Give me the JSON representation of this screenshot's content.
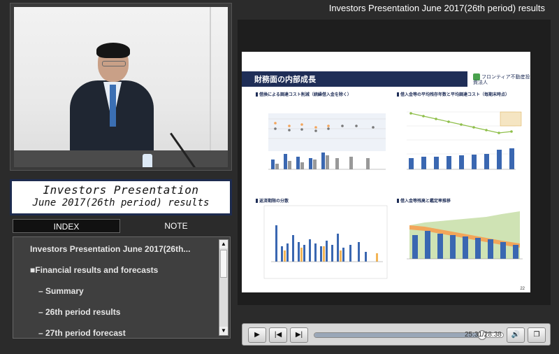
{
  "header": {
    "title": "Investors Presentation June 2017(26th period) results"
  },
  "player_title": {
    "line1": "Investors Presentation",
    "line2": "June 2017(26th period) results"
  },
  "tabs": {
    "index": "INDEX",
    "note": "NOTE"
  },
  "index": {
    "items": [
      "Investors Presentation June 2017(26th...",
      "■Financial results and forecasts",
      "– Summary",
      "– 26th period results",
      "– 27th period forecast"
    ]
  },
  "slide": {
    "title": "財務面の内部成長",
    "logo": "フロンティア不動産投資法人",
    "page": "22",
    "panels": [
      "借換による調達コスト削減（続繰借入金を除く）",
      "借入金等の平均残存年数と平均調達コスト（毎期末時点）",
      "返済期限の分散",
      "借入金等残高と鑑定率推移"
    ]
  },
  "player": {
    "time": "25:31/28:38",
    "progress": 0.89
  },
  "colors": {
    "slide_header": "#1f2e57",
    "accent": "#3a67b1"
  }
}
